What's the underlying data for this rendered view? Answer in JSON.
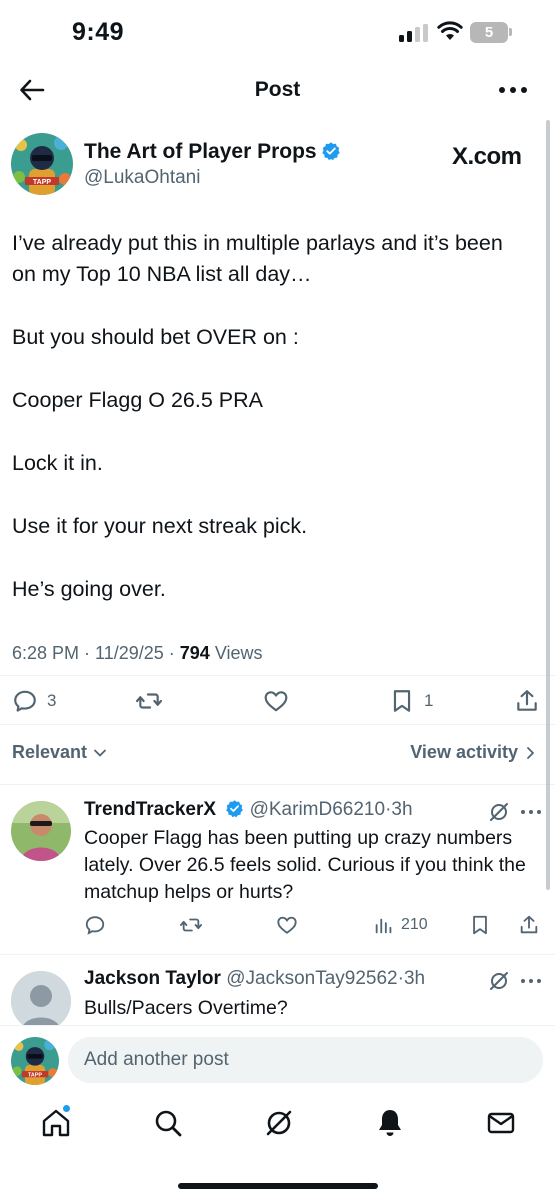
{
  "status_bar": {
    "time": "9:49",
    "battery_level": "5"
  },
  "header": {
    "title": "Post"
  },
  "post": {
    "author_name": "The Art of Player Props",
    "author_handle": "@LukaOhtani",
    "avatar_label": "TAPP",
    "source": "X.com",
    "body": [
      "I’ve already put this in multiple parlays and it’s been on my Top 10 NBA list all day…",
      "But you should bet OVER on :",
      "Cooper Flagg O 26.5 PRA",
      "Lock it in.",
      "Use it for your next streak pick.",
      "He’s going over."
    ],
    "time": "6:28 PM",
    "date": "11/29/25",
    "views_count": "794",
    "views_label": "Views",
    "replies_count": "3",
    "bookmarks_count": "1"
  },
  "filters": {
    "relevant_label": "Relevant",
    "view_activity_label": "View activity"
  },
  "replies": [
    {
      "name": "TrendTrackerX",
      "handle": "@KarimD66210",
      "time": "3h",
      "text": "Cooper Flagg has been putting up crazy numbers lately. Over 26.5 feels solid. Curious if you think the matchup helps or hurts?",
      "views": "210"
    },
    {
      "name": "Jackson Taylor",
      "handle": "@JacksonTay92562",
      "time": "3h",
      "text": "Bulls/Pacers Overtime?"
    }
  ],
  "composer": {
    "placeholder": "Add another post"
  },
  "colors": {
    "accent": "#1d9bf0",
    "text": "#0f1419",
    "secondary": "#536471",
    "divider": "#eff3f4"
  }
}
